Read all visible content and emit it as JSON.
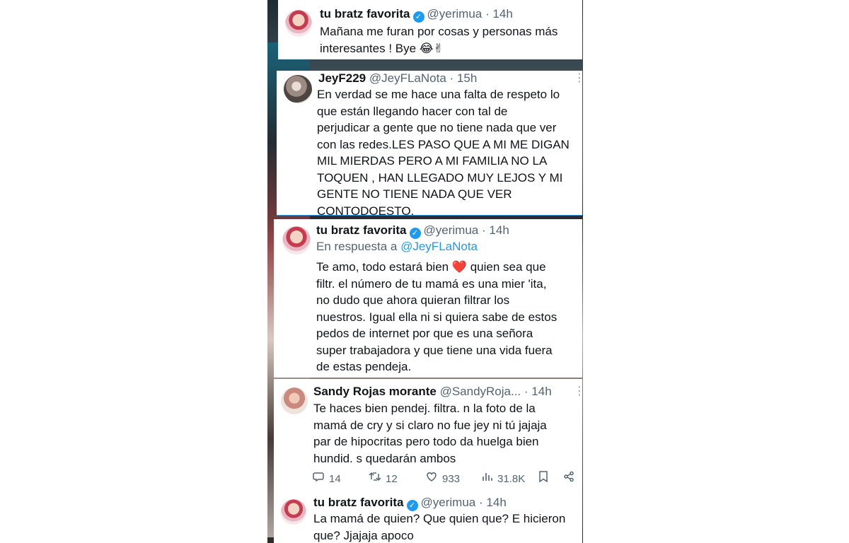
{
  "tweets": [
    {
      "name": "tu bratz favorita",
      "handle": "@yerimua",
      "time": "14h",
      "verified": true,
      "text": "Mañana me furan por cosas y personas más\ninteresantes ! Bye 😂✌"
    },
    {
      "name": "JeyF229",
      "handle": "@JeyFLaNota",
      "time": "15h",
      "verified": false,
      "text": "En verdad se me hace una falta de respeto lo\nque están llegando hacer con tal de\nperjudicar a gente que no tiene nada que ver\ncon las redes.LES PASO QUE A MI ME DIGAN\nMIL MIERDAS PERO A MI FAMILIA NO LA\nTOQUEN , HAN LLEGADO MUY LEJOS Y MI\nGENTE NO TIENE NADA QUE VER\nCONTODOESTO."
    },
    {
      "name": "tu bratz favorita",
      "handle": "@yerimua",
      "time": "14h",
      "verified": true,
      "reply_prefix": "En respuesta a",
      "reply_mention": "@JeyFLaNota",
      "text": "Te amo, todo estará bien ❤️ quien sea que\nfiltr. el número de tu mamá es una mier 'ita,\nno dudo que ahora quieran filtrar los\nnuestros. Igual ella ni si quiera sabe de estos\npedos de internet por que es una señora\nsuper trabajadora y que tiene una vida fuera\nde estas pendeja."
    },
    {
      "name": "Sandy Rojas morante",
      "handle": "@SandyRoja...",
      "time": "14h",
      "verified": false,
      "text": "Te haces bien pendej. filtra. n la foto de la\nmamá de cry y si claro no fue jey ni tú jajaja\npar de hipocritas pero todo da huelga bien\nhundid. s quedarán ambos",
      "actions": {
        "replies": "14",
        "retweets": "12",
        "likes": "933",
        "views": "31.8K"
      }
    },
    {
      "name": "tu bratz favorita",
      "handle": "@yerimua",
      "time": "14h",
      "verified": true,
      "text": "La mamá de quien? Que quien que? E hicieron\nque? Jjajaja apoco"
    }
  ],
  "sep": "·",
  "icons": {
    "verified": "verified-badge-icon",
    "more": "more-dots-icon",
    "reply": "reply-icon",
    "retweet": "retweet-icon",
    "like": "heart-icon",
    "views": "views-icon",
    "bookmark": "bookmark-icon",
    "share": "share-icon"
  },
  "colors": {
    "accent": "#1d9bf0",
    "text": "#0f1419",
    "muted": "#536471"
  }
}
